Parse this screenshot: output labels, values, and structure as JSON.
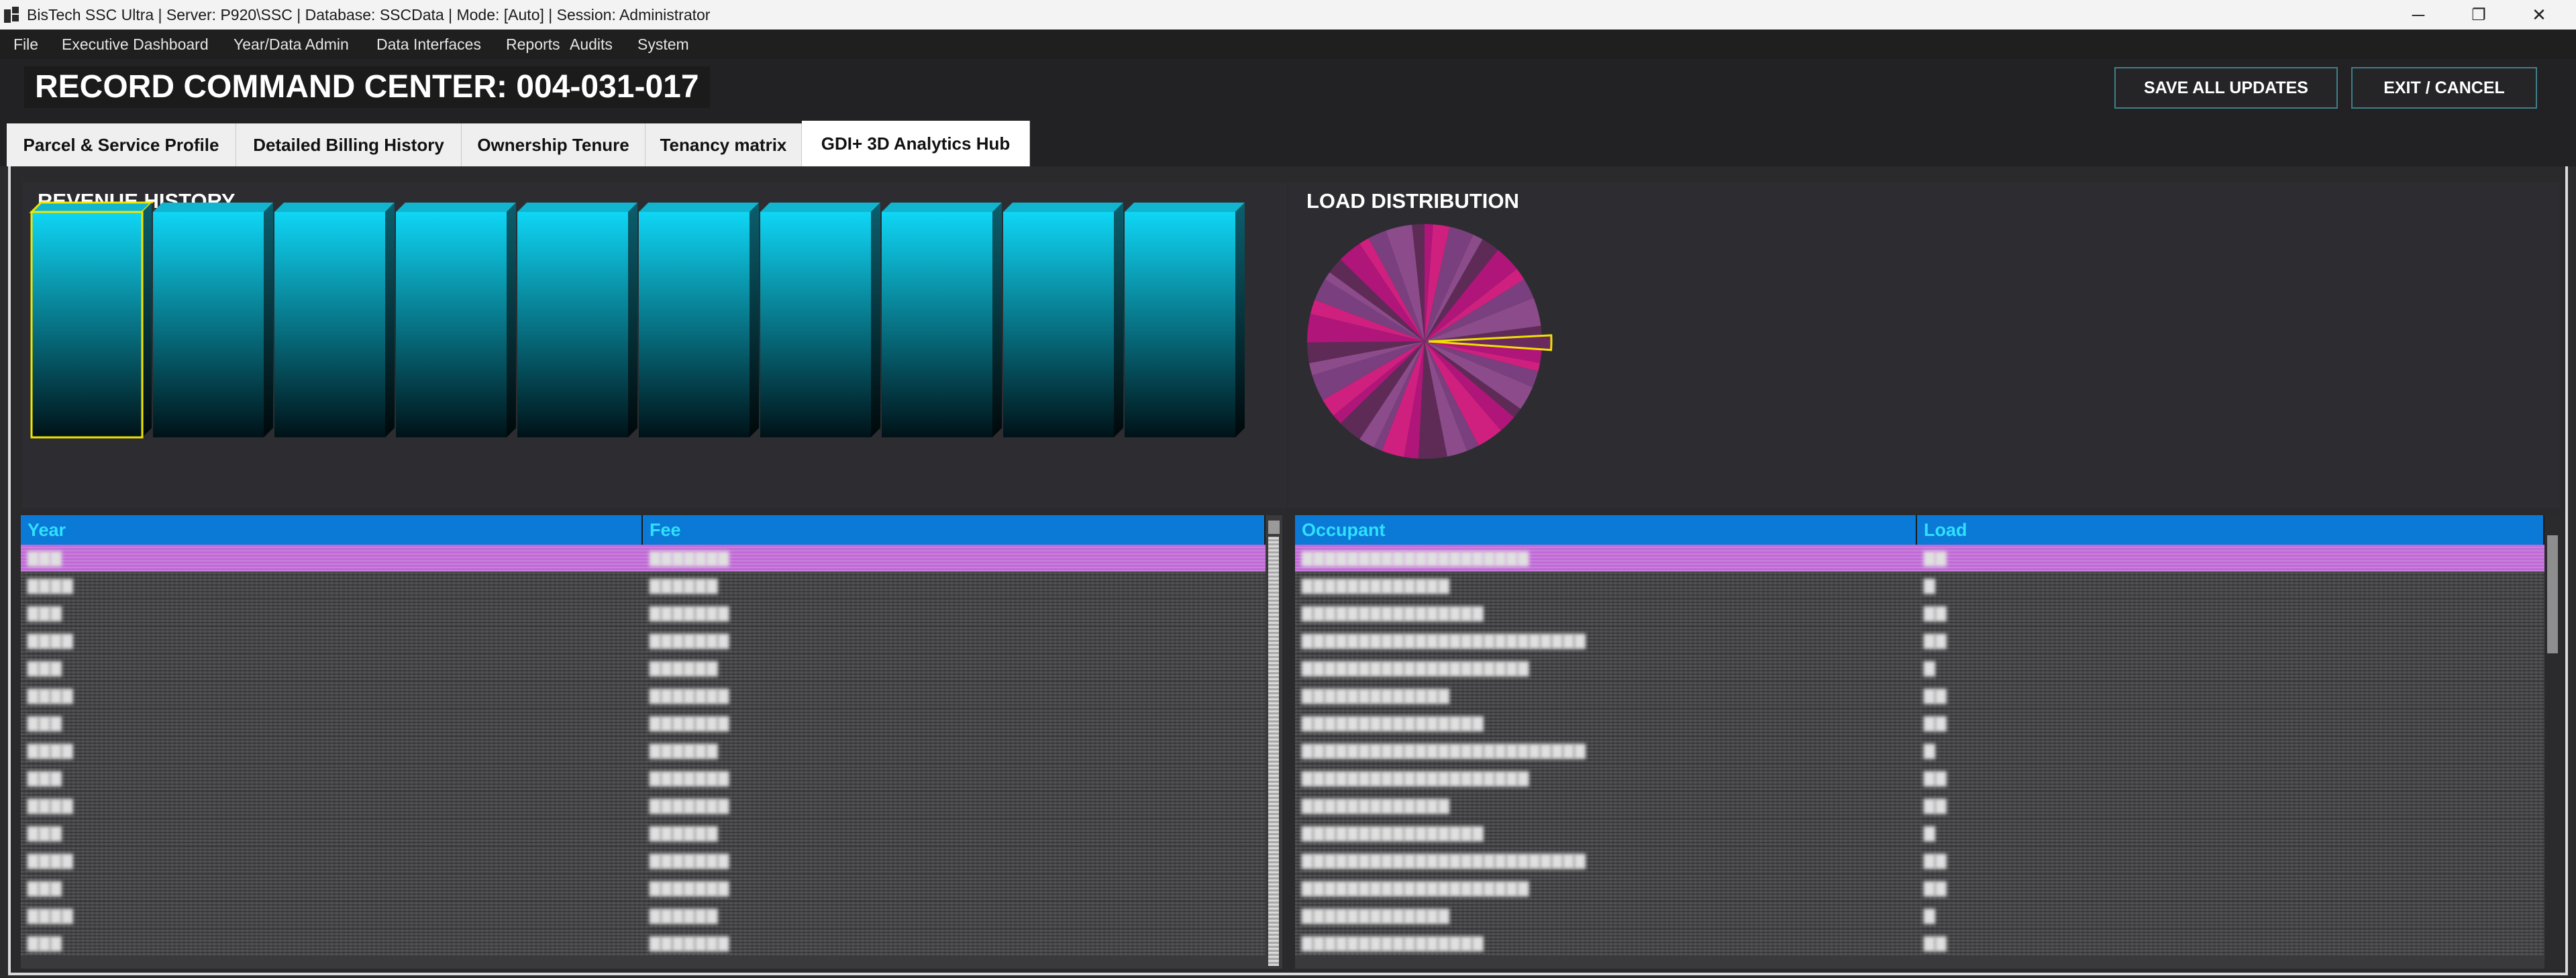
{
  "window": {
    "title": "BisTech SSC Ultra | Server: P920\\SSC | Database: SSCData | Mode: [Auto] | Session: Administrator",
    "minimize_glyph": "─",
    "maximize_glyph": "❐",
    "close_glyph": "✕"
  },
  "menu": [
    "File",
    "Executive Dashboard",
    "Year/Data Admin",
    "Data Interfaces",
    "Reports",
    "Audits",
    "System"
  ],
  "header": {
    "record_title": "RECORD COMMAND CENTER: 004-031-017",
    "save_label": "SAVE ALL UPDATES",
    "exit_label": "EXIT / CANCEL"
  },
  "tabs": [
    {
      "label": "Parcel & Service Profile"
    },
    {
      "label": "Detailed Billing History"
    },
    {
      "label": "Ownership Tenure"
    },
    {
      "label": "Tenancy matrix"
    },
    {
      "label": "GDI+ 3D Analytics Hub",
      "active": true
    }
  ],
  "revenue": {
    "title": "REVENUE HISTORY",
    "bar_count": 10,
    "selected_index": 0,
    "bar_color": "#0fd6f5"
  },
  "load": {
    "title": "LOAD DISTRIBUTION",
    "slice_count": 40,
    "colors": [
      "#b0157a",
      "#7a3f7e",
      "#5e2b56",
      "#d0207f",
      "#8c4b8a"
    ],
    "highlight_color": "#f0e000"
  },
  "fee_grid": {
    "columns": [
      "Year",
      "Fee"
    ],
    "row_count": 15,
    "selected_row": 0
  },
  "load_grid": {
    "columns": [
      "Occupant",
      "Load"
    ],
    "row_count": 15,
    "selected_row": 0
  },
  "colors": {
    "accent_header": "#0b79d6",
    "header_text": "#2fe0ff",
    "selected_row": "#c06ad6",
    "bar_highlight": "#f2e600"
  }
}
